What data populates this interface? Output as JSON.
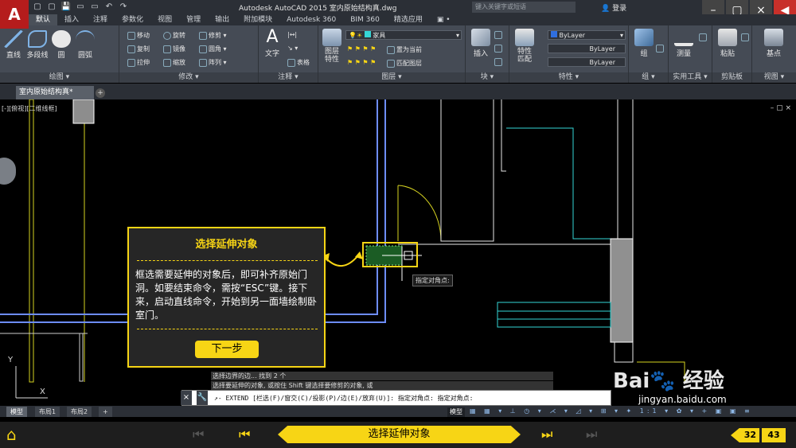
{
  "app": {
    "logo_letter": "A",
    "title": "Autodesk AutoCAD 2015    室内原始结构真.dwg",
    "search_placeholder": "键入关键字或短语",
    "login_label": "登录",
    "window_buttons": [
      "–",
      "▢",
      "×"
    ],
    "back_label": "◀"
  },
  "quick_access": [
    "▢",
    "▢",
    "💾",
    "▭",
    "▭",
    "↶",
    "↷"
  ],
  "ribbon": {
    "tabs": [
      "默认",
      "插入",
      "注释",
      "参数化",
      "视图",
      "管理",
      "输出",
      "附加模块",
      "Autodesk 360",
      "BIM 360",
      "精选应用",
      "▣ •"
    ],
    "active_tab": 0,
    "panels": {
      "draw": {
        "title": "绘图 ▾",
        "tools": [
          "直线",
          "多段线",
          "圆",
          "圆弧"
        ]
      },
      "modify": {
        "title": "修改 ▾",
        "tools": [
          "移动",
          "旋转",
          "修剪 ▾",
          "复制",
          "镜像",
          "圆角 ▾",
          "拉伸",
          "缩放",
          "阵列 ▾"
        ]
      },
      "annotation": {
        "title": "注释 ▾",
        "tools": [
          "文字",
          "表格"
        ]
      },
      "layers": {
        "title": "图层 ▾",
        "tools": [
          "图层\n特性",
          "置为当前",
          "匹配图层"
        ],
        "current_layer": "家具"
      },
      "block": {
        "title": "块 ▾",
        "tools": [
          "插入"
        ]
      },
      "properties": {
        "title": "特性 ▾",
        "tools": [
          "特性\n匹配"
        ],
        "color": "ByLayer",
        "linetype": "ByLayer",
        "lineweight": "ByLayer"
      },
      "group": {
        "title": "组 ▾",
        "tools": [
          "组"
        ]
      },
      "utilities": {
        "title": "实用工具 ▾",
        "tools": [
          "测量"
        ]
      },
      "clipboard": {
        "title": "剪贴板",
        "tools": [
          "粘贴"
        ]
      },
      "view": {
        "title": "视图 ▾",
        "tools": [
          "基点"
        ]
      }
    }
  },
  "document": {
    "tab_name": "室内原始结构真*",
    "add_tab": "+"
  },
  "canvas": {
    "view_label": "[-][俯视][二维线框]",
    "controls": "– ▢ ×",
    "corner_tooltip": "指定对角点:",
    "ucs_x": "X",
    "ucs_y": "Y"
  },
  "tutorial": {
    "title": "选择延伸对象",
    "body": "框选需要延伸的对象后，即可补齐原始门洞。如要结束命令，需按“ESC”键。接下来，启动直线命令，开始到另一面墙绘制卧室门。",
    "next_label": "下一步"
  },
  "command": {
    "history": [
      "选择边界的边... 找到 2 个",
      "选择要延伸的对象, 或按住 Shift 键选择要修剪的对象, 或"
    ],
    "close": "×",
    "wrench": "🔧",
    "current": "↗- EXTEND [栏选(F)/窗交(C)/投影(P)/边(E)/放弃(U)]: 指定对角点: 指定对角点:"
  },
  "layouts": {
    "tabs": [
      "模型",
      "布局1",
      "布局2",
      "+"
    ],
    "active": 0
  },
  "status": {
    "model_label": "模型",
    "icons": "▦ ▦ ▾ ⊥ ◷ ▾ ⋌ ▾ ◿ ▾ ⊞ ▾ ✦ 1:1 ▾ ✿ ▾ + ▣ ▣ ≡"
  },
  "nav": {
    "home": "⌂",
    "first": "⏮",
    "prev": "⏮",
    "banner": "选择延伸对象",
    "next": "⏭",
    "last": "⏭",
    "page_current": "32",
    "page_total": "43"
  },
  "watermark": {
    "logo": "Bai🐾 经验",
    "url": "jingyan.baidu.com"
  }
}
